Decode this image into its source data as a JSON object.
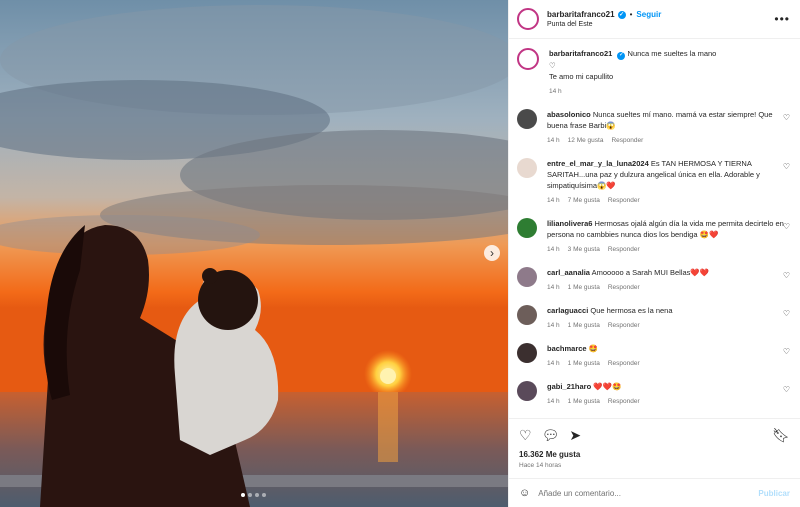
{
  "header": {
    "username": "barbaritafranco21",
    "follow": "Seguir",
    "separator": "•",
    "location": "Punta del Este",
    "more": "•••"
  },
  "caption": {
    "username": "barbaritafranco21",
    "line1": "Nunca me sueltes la mano",
    "line2": "♡",
    "line3": "Te amo mi capullito",
    "time": "14 h"
  },
  "comments": [
    {
      "username": "abasolonico",
      "text": "Nunca sueltes mí mano. mamá va estar siempre! Que buena frase Barbi😱",
      "time": "14 h",
      "likes": "12 Me gusta",
      "reply": "Responder",
      "avatar_color": "#4a4a4a"
    },
    {
      "username": "entre_el_mar_y_la_luna2024",
      "text": "Es TAN HERMOSA Y TIERNA SARITAH...una paz y dulzura angelical única en ella. Adorable y simpatiquísima😱❤️",
      "time": "14 h",
      "likes": "7 Me gusta",
      "reply": "Responder",
      "avatar_color": "#e8d9d0"
    },
    {
      "username": "lilianolivera6",
      "text": "Hermosas ojalá algún día la vida me permita decirtelo en persona no cambbies nunca dios los bendiga 🤩❤️",
      "time": "14 h",
      "likes": "3 Me gusta",
      "reply": "Responder",
      "avatar_color": "#2e7d32"
    },
    {
      "username": "carl_aanalia",
      "text": "Amooooo a Sarah MUI Bellas❤️❤️",
      "time": "14 h",
      "likes": "1 Me gusta",
      "reply": "Responder",
      "avatar_color": "#8e7a8a"
    },
    {
      "username": "carlaguacci",
      "text": "Que hermosa es la nena",
      "time": "14 h",
      "likes": "1 Me gusta",
      "reply": "Responder",
      "avatar_color": "#6d5e5a"
    },
    {
      "username": "bachmarce",
      "text": "🤩",
      "time": "14 h",
      "likes": "1 Me gusta",
      "reply": "Responder",
      "avatar_color": "#3b2f2f"
    },
    {
      "username": "gabi_21haro",
      "text": "❤️❤️🤩",
      "time": "14 h",
      "likes": "1 Me gusta",
      "reply": "Responder",
      "avatar_color": "#5a4a5a"
    }
  ],
  "actions": {
    "likes": "16.362 Me gusta",
    "time": "Hace 14 horas",
    "comment_placeholder": "Añade un comentario...",
    "post": "Publicar"
  },
  "colors": {
    "accent": "#0095f6",
    "meta": "#737373"
  }
}
